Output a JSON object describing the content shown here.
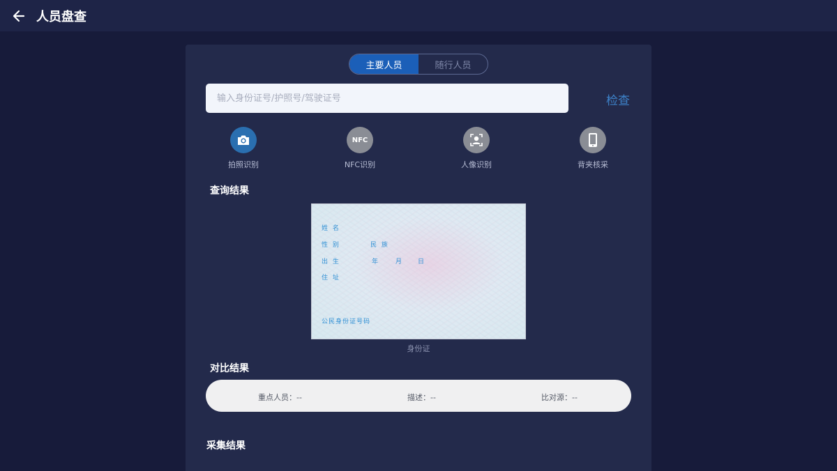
{
  "header": {
    "title": "人员盘查",
    "back_icon": "arrow-left-icon"
  },
  "tabs": [
    {
      "label": "主要人员",
      "active": true
    },
    {
      "label": "随行人员",
      "active": false
    }
  ],
  "search": {
    "placeholder": "输入身份证号/护照号/驾驶证号",
    "value": "",
    "check_label": "检查"
  },
  "actions": [
    {
      "label": "拍照识别",
      "icon": "camera-icon",
      "color": "#2a6fb0"
    },
    {
      "label": "NFC识别",
      "icon": "nfc-icon",
      "icon_text": "NFC",
      "color": "#8a8d95"
    },
    {
      "label": "人像识别",
      "icon": "face-scan-icon",
      "color": "#8a8d95"
    },
    {
      "label": "背夹核采",
      "icon": "phone-icon",
      "color": "#8a8d95"
    }
  ],
  "query_result": {
    "title": "查询结果",
    "id_card": {
      "name_label": "姓 名",
      "sex_label": "性 别",
      "ethnicity_label": "民 族",
      "birth_label": "出 生",
      "year_label": "年",
      "month_label": "月",
      "day_label": "日",
      "address_label": "住 址",
      "id_number_label": "公民身份证号码"
    },
    "caption": "身份证"
  },
  "compare_result": {
    "title": "对比结果",
    "key_person": "重点人员：--",
    "description": "描述：--",
    "source": "比对源：--"
  },
  "collect_result": {
    "title": "采集结果"
  },
  "colors": {
    "background": "#171b3a",
    "topbar": "#1e2447",
    "panel": "#232a4b",
    "accent": "#1b5fb8",
    "check_text": "#3d82c9"
  }
}
